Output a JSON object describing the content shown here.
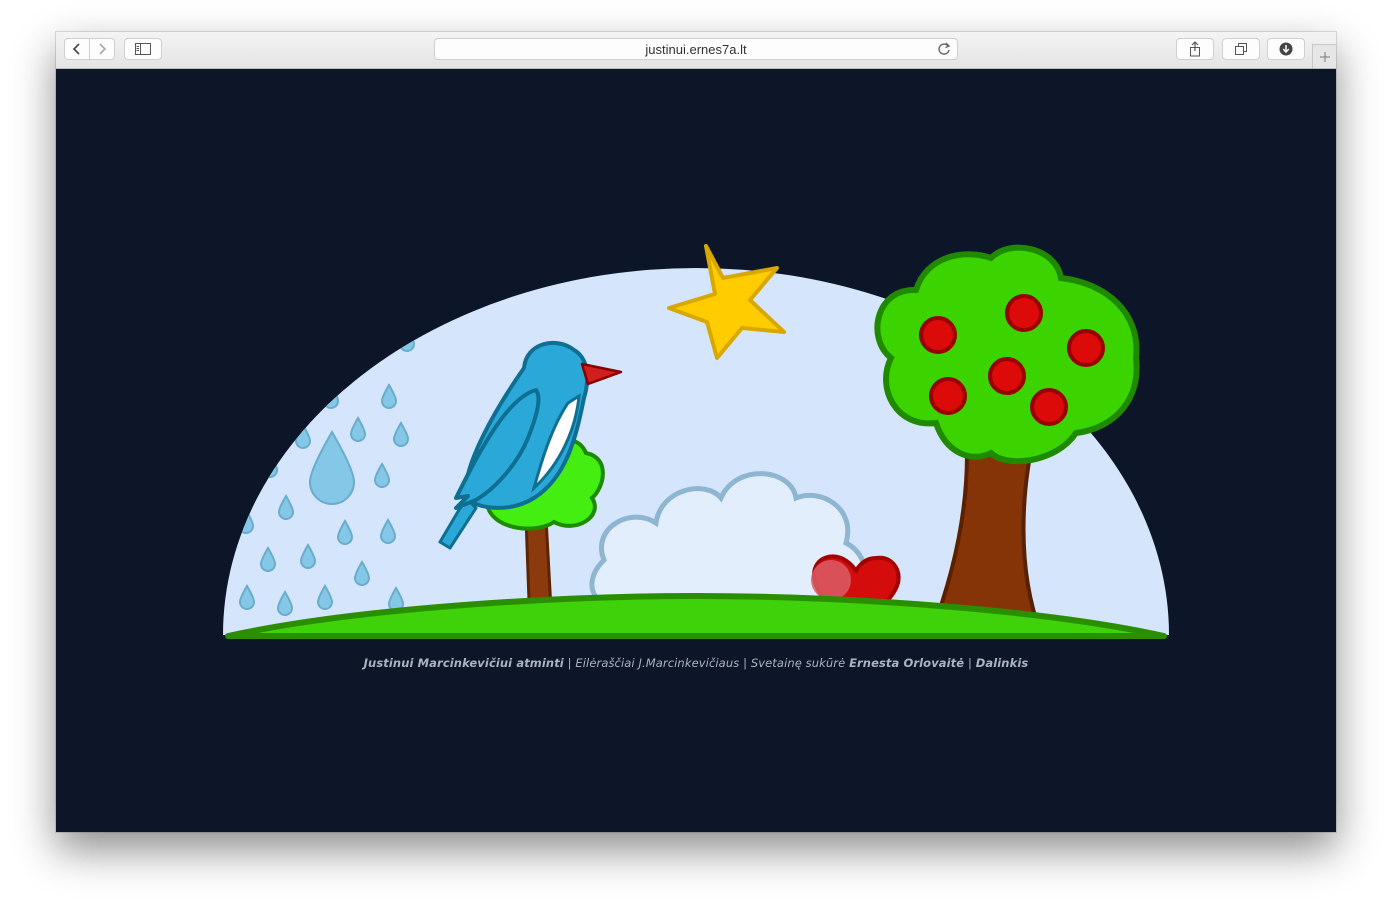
{
  "browser": {
    "url": "justinui.ernes7a.lt",
    "icons": {
      "back": "chevron-left-icon",
      "forward": "chevron-right-icon",
      "sidebar": "sidebar-icon",
      "reload": "reload-icon",
      "share": "share-icon",
      "tabs": "tabs-overview-icon",
      "downloads": "download-icon",
      "new_tab": "plus-icon"
    }
  },
  "footer": {
    "title": "Justinui Marcinkevičiui atminti",
    "separator": "|",
    "poems": "Eilėraščiai J.Marcinkevičiaus",
    "credit_prefix": "Svetainę sukūrė",
    "credit_name": "Ernesta Orlovaitė",
    "share": "Dalinkis"
  },
  "colors": {
    "page_background": "#0c1628",
    "sky": "#d5e5fb",
    "grass": "#3fd10a",
    "star": "#ffcc00",
    "bird": "#2aa8d8",
    "heart": "#d40c0c",
    "apple": "#dd0a0a",
    "footer_text": "#a9b4c1"
  }
}
